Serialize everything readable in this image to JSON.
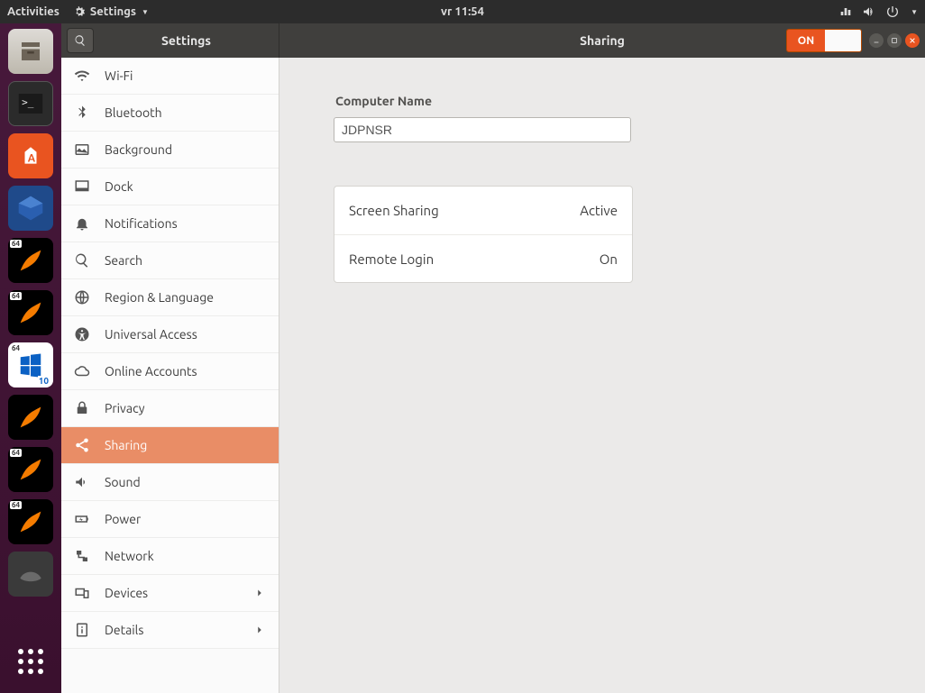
{
  "top_panel": {
    "activities": "Activities",
    "app_menu": "Settings",
    "clock": "vr 11:54"
  },
  "dock": {
    "badge64": "64"
  },
  "window": {
    "sidebar_title": "Settings",
    "content_title": "Sharing",
    "switch_on": "ON"
  },
  "sidebar": {
    "items": [
      {
        "label": "Wi-Fi"
      },
      {
        "label": "Bluetooth"
      },
      {
        "label": "Background"
      },
      {
        "label": "Dock"
      },
      {
        "label": "Notifications"
      },
      {
        "label": "Search"
      },
      {
        "label": "Region & Language"
      },
      {
        "label": "Universal Access"
      },
      {
        "label": "Online Accounts"
      },
      {
        "label": "Privacy"
      },
      {
        "label": "Sharing"
      },
      {
        "label": "Sound"
      },
      {
        "label": "Power"
      },
      {
        "label": "Network"
      },
      {
        "label": "Devices"
      },
      {
        "label": "Details"
      }
    ]
  },
  "content": {
    "computer_name_label": "Computer Name",
    "computer_name_value": "JDPNSR",
    "rows": {
      "screen_sharing": {
        "label": "Screen Sharing",
        "status": "Active"
      },
      "remote_login": {
        "label": "Remote Login",
        "status": "On"
      }
    }
  }
}
